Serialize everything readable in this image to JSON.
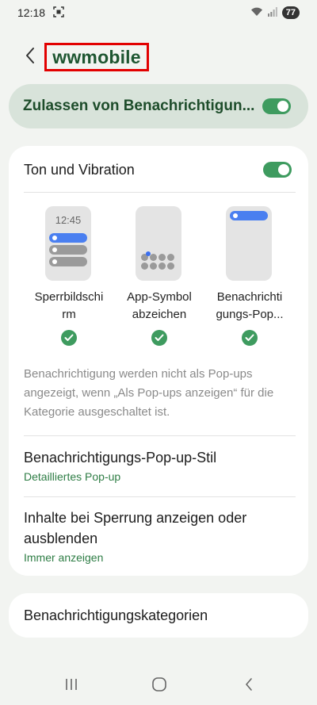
{
  "status_bar": {
    "time": "12:18",
    "battery": "77"
  },
  "header": {
    "title": "wwmobile"
  },
  "master_toggle": {
    "label": "Zulassen von Benachrichtigun...",
    "on": true
  },
  "sound_row": {
    "label": "Ton und Vibration",
    "on": true
  },
  "styles": [
    {
      "label": "Sperrbildschirm",
      "label_line1": "Sperrbildschi",
      "label_line2": "rm",
      "preview_time": "12:45",
      "checked": true
    },
    {
      "label": "App-Symbolabzeichen",
      "label_line1": "App-Symbol",
      "label_line2": "abzeichen",
      "checked": true
    },
    {
      "label": "Benachrichtigungs-Pop-ups",
      "label_line1": "Benachrichti",
      "label_line2": "gungs-Pop...",
      "checked": true
    }
  ],
  "note": "Benachrichtigung werden nicht als Pop-ups angezeigt, wenn „Als Pop-ups anzeigen“ für die Kategorie ausgeschaltet ist.",
  "popup_style": {
    "title": "Benachrichtigungs-Pop-up-Stil",
    "value": "Detailliertes Pop-up"
  },
  "lockscreen_content": {
    "title": "Inhalte bei Sperrung anzeigen oder ausblenden",
    "value": "Immer anzeigen"
  },
  "categories": {
    "title": "Benachrichtigungskategorien"
  },
  "colors": {
    "accent": "#3e9b5f",
    "title": "#1e5631",
    "highlight_border": "#e20000"
  }
}
